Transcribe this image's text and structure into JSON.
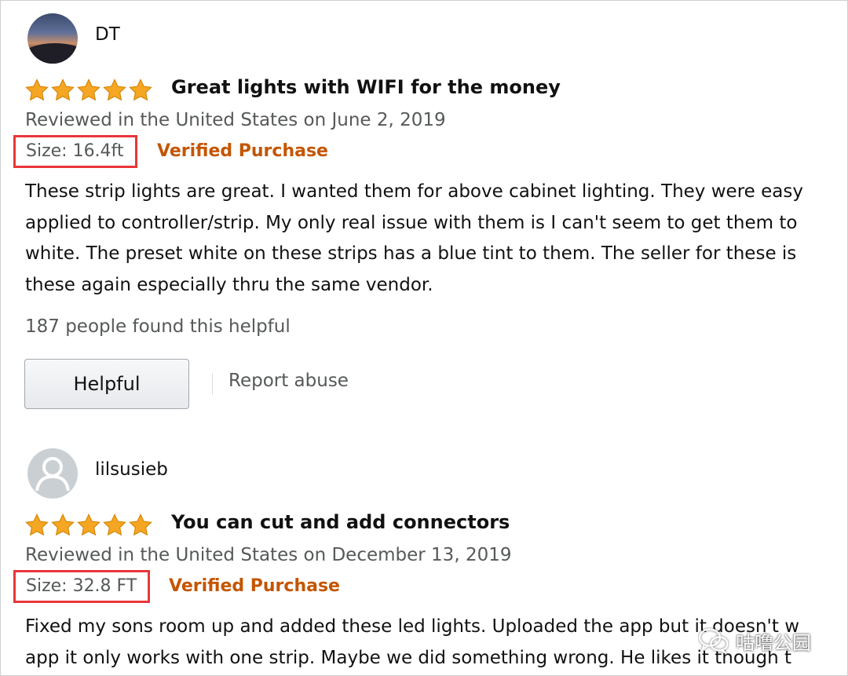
{
  "reviews": [
    {
      "username": "DT",
      "avatar_icon": "landscape-photo-avatar",
      "rating": 5,
      "title": "Great lights with WIFI for the money",
      "reviewed_in": "Reviewed in the United States on June 2, 2019",
      "size": "Size: 16.4ft",
      "verified": "Verified Purchase",
      "body": [
        "These strip lights are great. I wanted them for above cabinet lighting. They were easy",
        "applied to controller/strip. My only real issue with them is I can't seem to get them to",
        "white. The preset white on these strips has a blue tint to them. The seller for these is",
        "these again especially thru the same vendor."
      ],
      "helpful_count": "187 people found this helpful",
      "helpful_label": "Helpful",
      "report_label": "Report abuse"
    },
    {
      "username": "lilsusieb",
      "avatar_icon": "default-user-avatar",
      "rating": 5,
      "title": "You can cut and add connectors",
      "reviewed_in": "Reviewed in the United States on December 13, 2019",
      "size": "Size: 32.8 FT",
      "verified": "Verified Purchase",
      "body": [
        "Fixed my sons room up and added these led lights. Uploaded the app but it doesn't w",
        "app it only works with one strip. Maybe we did something wrong. He likes it though t"
      ]
    }
  ],
  "watermark": {
    "icon": "wechat-icon",
    "text": "咕噜公园"
  },
  "colors": {
    "star": "#f5a623",
    "verified": "#c45500",
    "highlight_box": "#e8363a",
    "muted_text": "#565959"
  }
}
